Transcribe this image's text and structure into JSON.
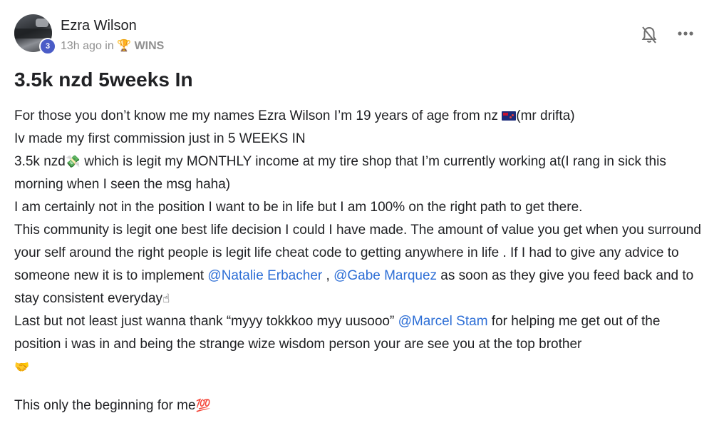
{
  "author": {
    "name": "Ezra Wilson",
    "level": "3",
    "time": "13h ago",
    "in_label": "in",
    "category_icon": "trophy-icon",
    "category": "WINS"
  },
  "actions": {
    "bell_icon": "bell-off-icon",
    "more_icon": "more-dots-icon"
  },
  "post": {
    "title": "3.5k nzd 5weeks In",
    "lines": {
      "l1a": "For those you don’t know me my names Ezra Wilson I’m 19 years of age from nz ",
      "l1b": "(mr drifta)",
      "l2": "Iv made my first commission just in 5 WEEKS IN",
      "l3a": "3.5k nzd",
      "l3e": "💸",
      "l3b": " which is legit my MONTHLY income at my tire shop that I’m currently working at(I rang in sick this morning when I seen the msg haha)",
      "l4": "I am certainly not in the position I want to be in life but I am 100% on the right path to get there.",
      "l5a": "This community is legit one best life decision I could I have made. The amount of value you get when you surround your self around the right people is legit life cheat code to getting anywhere in life . If I had to give any advice to someone new it is to implement ",
      "m1": "@Natalie Erbacher",
      "l5b": " , ",
      "m2": "@Gabe Marquez",
      "l5c": " as soon as they give you feed back and to stay consistent everyday",
      "l5e": "☝",
      "l6a": "Last but not least just wanna thank “myyy tokkkoo myy uusooo” ",
      "m3": "@Marcel Stam",
      "l6b": " for helping me get out of the position i was in and being the strange wize wisdom person your are see you at the top brother",
      "l6e": "🤝",
      "l7": "This only the beginning for me",
      "l7e": "💯"
    }
  }
}
